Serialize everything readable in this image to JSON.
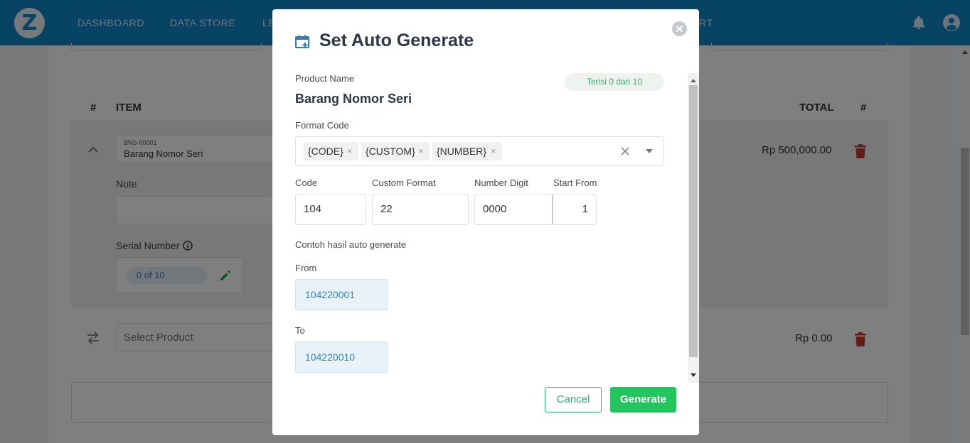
{
  "app": {
    "logo_letter": "Z",
    "nav": [
      "DASHBOARD",
      "DATA STORE",
      "LE",
      "RT"
    ],
    "table_headers": {
      "hash": "#",
      "item": "ITEM",
      "total": "TOTAL",
      "hash_right": "#"
    },
    "row": {
      "item_code": "BNS-00001",
      "item_name": "Barang Nomor Seri",
      "note_label": "Note",
      "serial_label": "Serial Number",
      "serial_count": "0 of 10",
      "total": "Rp 500,000.00"
    },
    "new_row": {
      "select_placeholder": "Select Product",
      "total": "Rp 0.00"
    },
    "colors": {
      "topbar": "#0f86c8",
      "danger": "#c0392b",
      "success": "#2fb36a"
    }
  },
  "modal": {
    "title": "Set Auto Generate",
    "product_name_label": "Product Name",
    "product_name": "Barang Nomor Seri",
    "badge": "Terisi 0 dari 10",
    "format_code_label": "Format Code",
    "format_tokens": [
      "{CODE}",
      "{CUSTOM}",
      "{NUMBER}"
    ],
    "fields": {
      "code_label": "Code",
      "code_value": "104",
      "custom_label": "Custom Format",
      "custom_value": "22",
      "digit_label": "Number Digit",
      "digit_value": "0000",
      "start_label": "Start From",
      "start_value": "1"
    },
    "example_label": "Contoh hasil auto generate",
    "from_label": "From",
    "from_value": "104220001",
    "to_label": "To",
    "to_value": "104220010",
    "cancel_label": "Cancel",
    "generate_label": "Generate"
  }
}
